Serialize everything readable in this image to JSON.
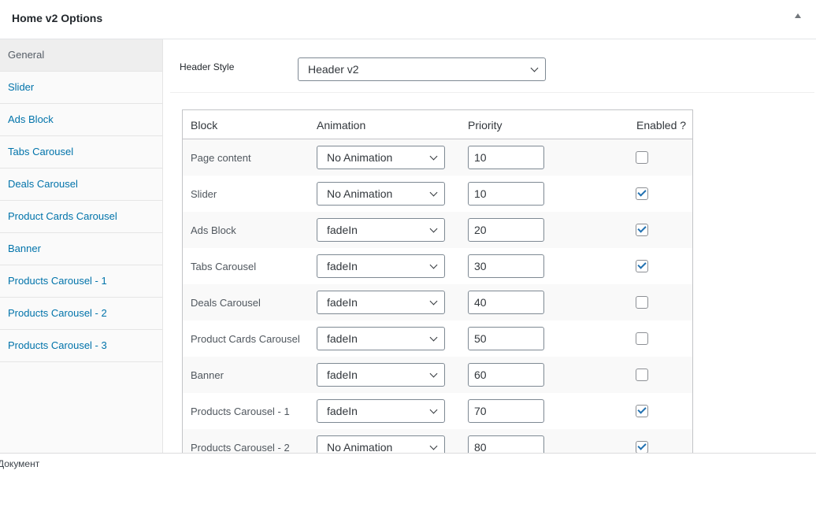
{
  "panel": {
    "title": "Home v2 Options"
  },
  "sidebar": {
    "items": [
      {
        "label": "General",
        "active": true
      },
      {
        "label": "Slider"
      },
      {
        "label": "Ads Block"
      },
      {
        "label": "Tabs Carousel"
      },
      {
        "label": "Deals Carousel"
      },
      {
        "label": "Product Cards Carousel"
      },
      {
        "label": "Banner"
      },
      {
        "label": "Products Carousel - 1"
      },
      {
        "label": "Products Carousel - 2"
      },
      {
        "label": "Products Carousel - 3"
      }
    ]
  },
  "header_style": {
    "label": "Header Style",
    "value": "Header v2"
  },
  "table": {
    "headers": {
      "block": "Block",
      "animation": "Animation",
      "priority": "Priority",
      "enabled": "Enabled ?"
    },
    "rows": [
      {
        "block": "Page content",
        "animation": "No Animation",
        "priority": "10",
        "enabled": false
      },
      {
        "block": "Slider",
        "animation": "No Animation",
        "priority": "10",
        "enabled": true
      },
      {
        "block": "Ads Block",
        "animation": "fadeIn",
        "priority": "20",
        "enabled": true
      },
      {
        "block": "Tabs Carousel",
        "animation": "fadeIn",
        "priority": "30",
        "enabled": true
      },
      {
        "block": "Deals Carousel",
        "animation": "fadeIn",
        "priority": "40",
        "enabled": false
      },
      {
        "block": "Product Cards Carousel",
        "animation": "fadeIn",
        "priority": "50",
        "enabled": false
      },
      {
        "block": "Banner",
        "animation": "fadeIn",
        "priority": "60",
        "enabled": false
      },
      {
        "block": "Products Carousel - 1",
        "animation": "fadeIn",
        "priority": "70",
        "enabled": true
      },
      {
        "block": "Products Carousel - 2",
        "animation": "No Animation",
        "priority": "80",
        "enabled": true
      }
    ]
  },
  "status_bar": {
    "text": "Документ"
  },
  "icons": {
    "collapse": "triangle-up-icon",
    "dropdown": "chevron-down-icon",
    "check": "checkmark-icon"
  },
  "colors": {
    "link": "#0073aa",
    "check": "#2271b1"
  }
}
